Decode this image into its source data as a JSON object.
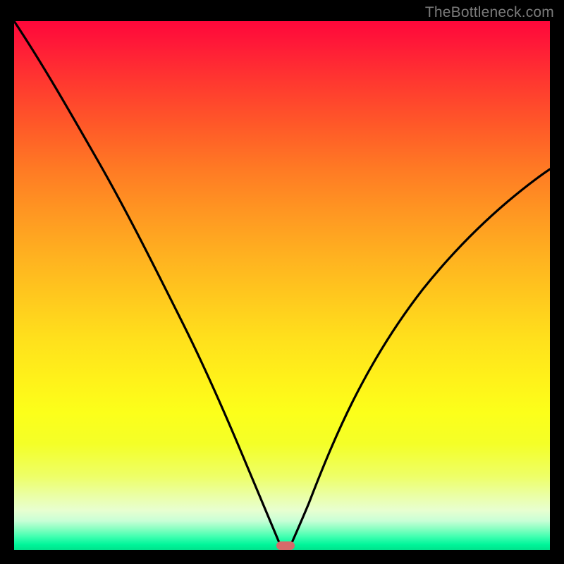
{
  "watermark": {
    "text": "TheBottleneck.com"
  },
  "colors": {
    "bg": "#000000",
    "curve": "#000000",
    "marker": "#d66a6a",
    "gradient_top": "#ff073a",
    "gradient_bottom": "#00e28c"
  },
  "chart_data": {
    "type": "line",
    "title": "",
    "xlabel": "",
    "ylabel": "",
    "xlim": [
      0,
      100
    ],
    "ylim": [
      0,
      100
    ],
    "x": [
      0,
      5,
      10,
      15,
      20,
      25,
      30,
      35,
      40,
      42,
      45,
      47,
      48,
      49,
      50,
      51,
      52,
      55,
      60,
      65,
      70,
      75,
      80,
      85,
      90,
      95,
      100
    ],
    "values": [
      100,
      94,
      88,
      82,
      76,
      69,
      61,
      52,
      40,
      33,
      22,
      12,
      7,
      3,
      0,
      3,
      8,
      20,
      34,
      44,
      51,
      57,
      61,
      65,
      68,
      70,
      72
    ],
    "notch_marker": {
      "x": 50,
      "y": 0,
      "color": "#d66a6a"
    },
    "color_scale": "red-yellow-green vertical gradient (high=red, low=green)"
  }
}
